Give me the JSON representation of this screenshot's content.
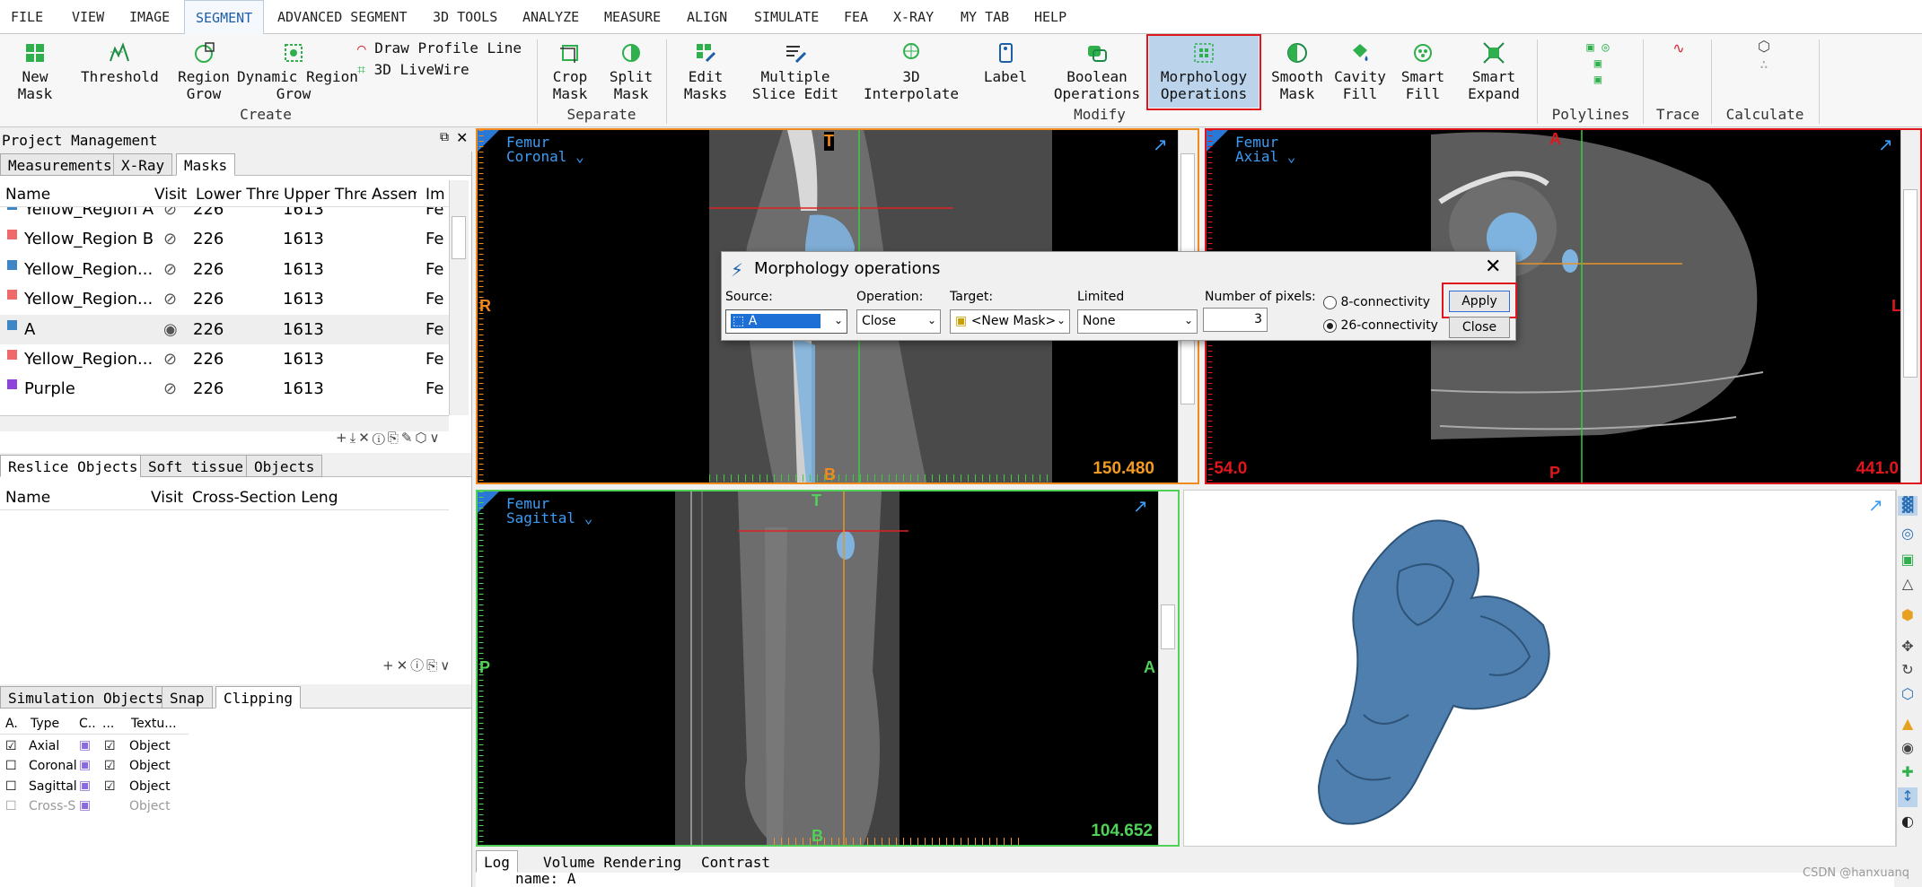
{
  "menu": [
    "FILE",
    "VIEW",
    "IMAGE",
    "SEGMENT",
    "ADVANCED SEGMENT",
    "3D TOOLS",
    "ANALYZE",
    "MEASURE",
    "ALIGN",
    "SIMULATE",
    "FEA",
    "X-RAY",
    "MY TAB",
    "HELP"
  ],
  "ribbon": {
    "new_mask": "New\nMask",
    "threshold": "Threshold",
    "region_grow": "Region\nGrow",
    "dynamic_region_grow": "Dynamic Region\nGrow",
    "draw_profile_line": "Draw Profile Line",
    "livewire": "3D LiveWire",
    "crop_mask": "Crop\nMask",
    "split_mask": "Split\nMask",
    "edit_masks": "Edit\nMasks",
    "multiple_slice_edit": "Multiple\nSlice Edit",
    "interpolate": "3D Interpolate",
    "label": "Label",
    "boolean_operations": "Boolean\nOperations",
    "morphology_operations": "Morphology\nOperations",
    "smooth_mask": "Smooth\nMask",
    "cavity_fill": "Cavity\nFill",
    "smart_fill": "Smart\nFill",
    "smart_expand": "Smart\nExpand",
    "groups": {
      "create": "Create",
      "separate": "Separate",
      "modify": "Modify",
      "polylines": "Polylines",
      "trace": "Trace",
      "calculate": "Calculate"
    }
  },
  "project": {
    "title": "Project Management",
    "tabs": [
      "Measurements",
      "X-Ray",
      "Masks"
    ],
    "columns": [
      "Name",
      "Visit",
      "Lower Thre",
      "Upper Thre",
      "Assem",
      "Im"
    ],
    "rows": [
      {
        "name": "Yellow_Region A",
        "lower": "226",
        "upper": "1613",
        "im": "Fe",
        "color": "#3f86c6",
        "visible": false
      },
      {
        "name": "Yellow_Region B",
        "lower": "226",
        "upper": "1613",
        "im": "Fe",
        "color": "#ef6a6a",
        "visible": false
      },
      {
        "name": "Yellow_Region...",
        "lower": "226",
        "upper": "1613",
        "im": "Fe",
        "color": "#3f86c6",
        "visible": false
      },
      {
        "name": "Yellow_Region...",
        "lower": "226",
        "upper": "1613",
        "im": "Fe",
        "color": "#ef6a6a",
        "visible": false
      },
      {
        "name": "A",
        "lower": "226",
        "upper": "1613",
        "im": "Fe",
        "color": "#3f86c6",
        "visible": true
      },
      {
        "name": "Yellow_Region...",
        "lower": "226",
        "upper": "1613",
        "im": "Fe",
        "color": "#ef6a6a",
        "visible": false
      },
      {
        "name": "Purple",
        "lower": "226",
        "upper": "1613",
        "im": "Fe",
        "color": "#8e44d8",
        "visible": false
      }
    ]
  },
  "reslice": {
    "tabs": [
      "Reslice Objects",
      "Soft tissue",
      "Objects"
    ],
    "columns": [
      "Name",
      "Visit",
      "Cross-Section Leng"
    ]
  },
  "simulation": {
    "tabs": [
      "Simulation Objects",
      "Snap",
      "Clipping"
    ],
    "columns": [
      "A.",
      "Type",
      "C..",
      "...",
      "Textu..."
    ],
    "rows": [
      {
        "checked": true,
        "type": "Axial",
        "object_checked": true,
        "object": "Object"
      },
      {
        "checked": false,
        "type": "Coronal",
        "object_checked": true,
        "object": "Object"
      },
      {
        "checked": false,
        "type": "Sagittal",
        "object_checked": true,
        "object": "Object"
      },
      {
        "checked": false,
        "type": "Cross-S",
        "object_checked": false,
        "object": "Object"
      }
    ]
  },
  "views": {
    "coronal": {
      "line1": "Femur",
      "line2": "Coronal",
      "value": "150.480",
      "top": "T",
      "bottom": "B",
      "left": "R"
    },
    "axial": {
      "line1": "Femur",
      "line2": "Axial",
      "value": "441.0",
      "value_left": "-54.0",
      "top": "A",
      "bottom": "P",
      "right": "L"
    },
    "sagittal": {
      "line1": "Femur",
      "line2": "Sagittal",
      "value": "104.652",
      "top": "T",
      "bottom": "B",
      "left": "P",
      "right": "A"
    }
  },
  "dialog": {
    "title": "Morphology operations",
    "source_label": "Source:",
    "source_value": "A",
    "operation_label": "Operation:",
    "operation_value": "Close",
    "target_label": "Target:",
    "target_value": "<New Mask>",
    "limited_label": "Limited",
    "limited_value": "None",
    "pixels_label": "Number of pixels:",
    "pixels_value": "3",
    "conn8": "8-connectivity",
    "conn26": "26-connectivity",
    "apply": "Apply",
    "close": "Close"
  },
  "bottom": {
    "tabs": [
      "Log",
      "Volume Rendering",
      "Contrast"
    ],
    "log_line": "name: A",
    "watermark": "CSDN @hanxuanq"
  },
  "colors": {
    "accent": "#1d5fa6",
    "highlight": "#e0161e",
    "coronal_border": "#f08a1c",
    "axial_border": "#e0161e",
    "sagittal_border": "#52d158",
    "mask_blue": "#3f86c6"
  }
}
